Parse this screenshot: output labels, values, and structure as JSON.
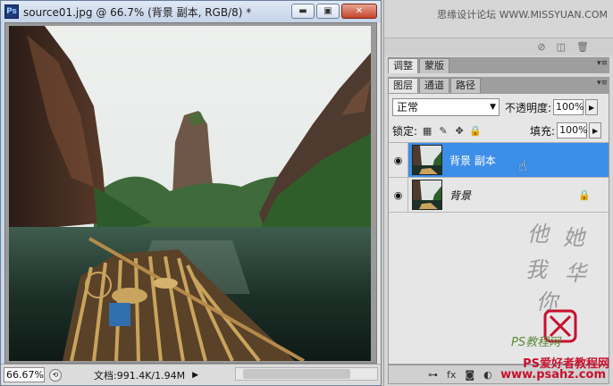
{
  "document": {
    "title": "source01.jpg @ 66.7% (背景 副本, RGB/8) *",
    "app_badge": "Ps",
    "window_buttons": {
      "minimize": "▬",
      "restore": "▣",
      "close": "✕"
    },
    "zoom": "66.67%",
    "doc_size": "文档:991.4K/1.94M",
    "status_arrow": "▶"
  },
  "panel": {
    "watermark_top": "思缘设计论坛 WWW.MISSYUAN.COM",
    "adjust_tabs": [
      {
        "label": "调整",
        "active": true
      },
      {
        "label": "蒙版",
        "active": false
      }
    ],
    "layer_tabs": [
      {
        "label": "图层",
        "active": true
      },
      {
        "label": "通道",
        "active": false
      },
      {
        "label": "路径",
        "active": false
      }
    ],
    "panel_menu_icon": "▾≡",
    "blend_mode": "正常",
    "opacity_label": "不透明度:",
    "opacity_value": "100%",
    "lock_label": "锁定:",
    "fill_label": "填充:",
    "fill_value": "100%",
    "layers": [
      {
        "name": "背景 副本",
        "selected": true,
        "visible": true
      },
      {
        "name": "背景",
        "selected": false,
        "visible": true,
        "locked": true
      }
    ],
    "calligraphy": "他她我华你",
    "watermark_bottom1": "PS教程网",
    "watermark_bottom2": "PS爱好者教程网",
    "watermark_bottom3": "www.psahz.com"
  },
  "colors": {
    "selected_layer": "#3d8ee6",
    "title_bar": "#c5d4e8",
    "watermark_red": "#c8102e"
  }
}
